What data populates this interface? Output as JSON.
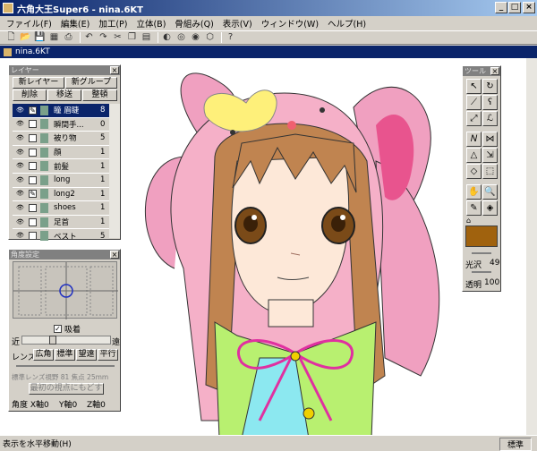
{
  "window": {
    "title": "六角大王Super6 - nina.6KT"
  },
  "menu": [
    "ファイル(F)",
    "編集(E)",
    "加工(P)",
    "立体(B)",
    "骨組み(Q)",
    "表示(V)",
    "ウィンドウ(W)",
    "ヘルプ(H)"
  ],
  "document": {
    "tab": "nina.6KT"
  },
  "layer_panel": {
    "title": "レイヤー",
    "buttons": {
      "new_layer": "新レイヤー",
      "new_group": "新グループ",
      "delete": "削除",
      "move": "移送",
      "arrange": "整頓"
    },
    "layers": [
      {
        "name": "瞳 眉睫",
        "count": "8"
      },
      {
        "name": "瞬間手...",
        "count": "0"
      },
      {
        "name": "被り物",
        "count": "5"
      },
      {
        "name": "顔",
        "count": "1"
      },
      {
        "name": "前髪",
        "count": "1"
      },
      {
        "name": "long",
        "count": "1"
      },
      {
        "name": "long2",
        "count": "1"
      },
      {
        "name": "shoes",
        "count": "1"
      },
      {
        "name": "足首",
        "count": "1"
      },
      {
        "name": "ベスト",
        "count": "5"
      }
    ]
  },
  "view_panel": {
    "title": "角度設定",
    "suction_label": "吸着",
    "near_label": "近",
    "far_label": "遠",
    "lens_label": "レンズ",
    "lens_buttons": [
      "広角",
      "標準",
      "望遠",
      "平行"
    ],
    "lens_info": "標準レンズ視野 81 焦点 25mm",
    "reset_button": "最初の視点にもどす",
    "angle_label": "角度 X軸0",
    "y_axis": "Y軸0",
    "z_axis": "Z軸0"
  },
  "tools_panel": {
    "title": "ツール",
    "gloss_label": "光沢",
    "gloss_value": "49",
    "transparency_label": "透明",
    "transparency_value": "100",
    "color": "#a0620e"
  },
  "status": {
    "left": "表示を水平移動(H)",
    "right": "標準"
  }
}
